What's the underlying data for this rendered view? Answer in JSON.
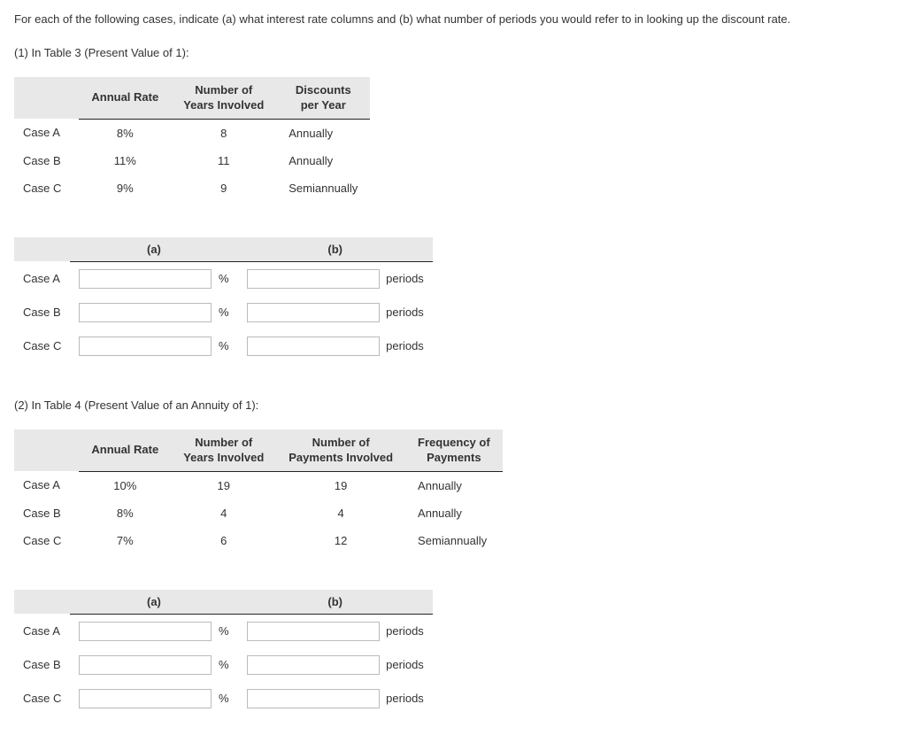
{
  "question": "For each of the following cases, indicate (a) what interest rate columns and (b) what number of periods you would refer to in looking up the discount rate.",
  "part1": {
    "heading": "(1) In Table 3 (Present Value of 1):",
    "headers": {
      "rate": "Annual Rate",
      "years": "Number of\nYears Involved",
      "discounts": "Discounts\nper Year"
    },
    "rows": [
      {
        "label": "Case A",
        "rate": "8%",
        "years": "8",
        "discounts": "Annually"
      },
      {
        "label": "Case B",
        "rate": "11%",
        "years": "11",
        "discounts": "Annually"
      },
      {
        "label": "Case C",
        "rate": "9%",
        "years": "9",
        "discounts": "Semiannually"
      }
    ]
  },
  "answer1": {
    "col_a": "(a)",
    "col_b": "(b)",
    "unit_a": "%",
    "unit_b": "periods",
    "rows": [
      {
        "label": "Case A"
      },
      {
        "label": "Case B"
      },
      {
        "label": "Case C"
      }
    ]
  },
  "part2": {
    "heading": "(2) In Table 4 (Present Value of an Annuity of 1):",
    "headers": {
      "rate": "Annual Rate",
      "years": "Number of\nYears Involved",
      "payments": "Number of\nPayments Involved",
      "freq": "Frequency of\nPayments"
    },
    "rows": [
      {
        "label": "Case A",
        "rate": "10%",
        "years": "19",
        "payments": "19",
        "freq": "Annually"
      },
      {
        "label": "Case B",
        "rate": "8%",
        "years": "4",
        "payments": "4",
        "freq": "Annually"
      },
      {
        "label": "Case C",
        "rate": "7%",
        "years": "6",
        "payments": "12",
        "freq": "Semiannually"
      }
    ]
  },
  "answer2": {
    "col_a": "(a)",
    "col_b": "(b)",
    "unit_a": "%",
    "unit_b": "periods",
    "rows": [
      {
        "label": "Case A"
      },
      {
        "label": "Case B"
      },
      {
        "label": "Case C"
      }
    ]
  }
}
